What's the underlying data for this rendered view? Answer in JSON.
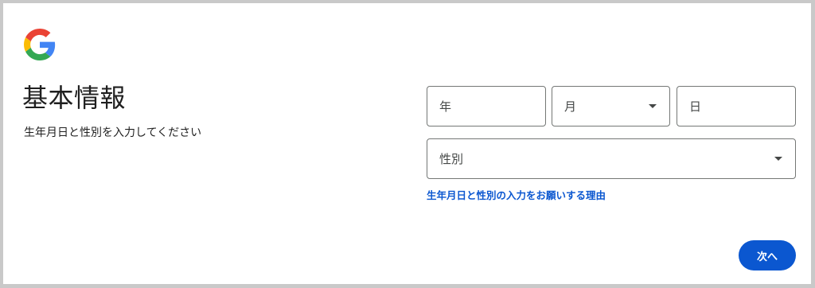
{
  "page": {
    "title": "基本情報",
    "subtitle": "生年月日と性別を入力してください"
  },
  "form": {
    "year_label": "年",
    "month_label": "月",
    "day_label": "日",
    "gender_label": "性別",
    "reason_link": "生年月日と性別の入力をお願いする理由"
  },
  "actions": {
    "next_label": "次へ"
  },
  "icons": {
    "logo": "google-g-icon",
    "month_dropdown": "dropdown-arrow-icon",
    "gender_dropdown": "dropdown-arrow-icon"
  },
  "colors": {
    "accent": "#0b57d0",
    "field_border": "#747775",
    "text": "#1f1f1f",
    "logo_blue": "#4285F4",
    "logo_red": "#EA4335",
    "logo_yellow": "#FBBC05",
    "logo_green": "#34A853"
  }
}
